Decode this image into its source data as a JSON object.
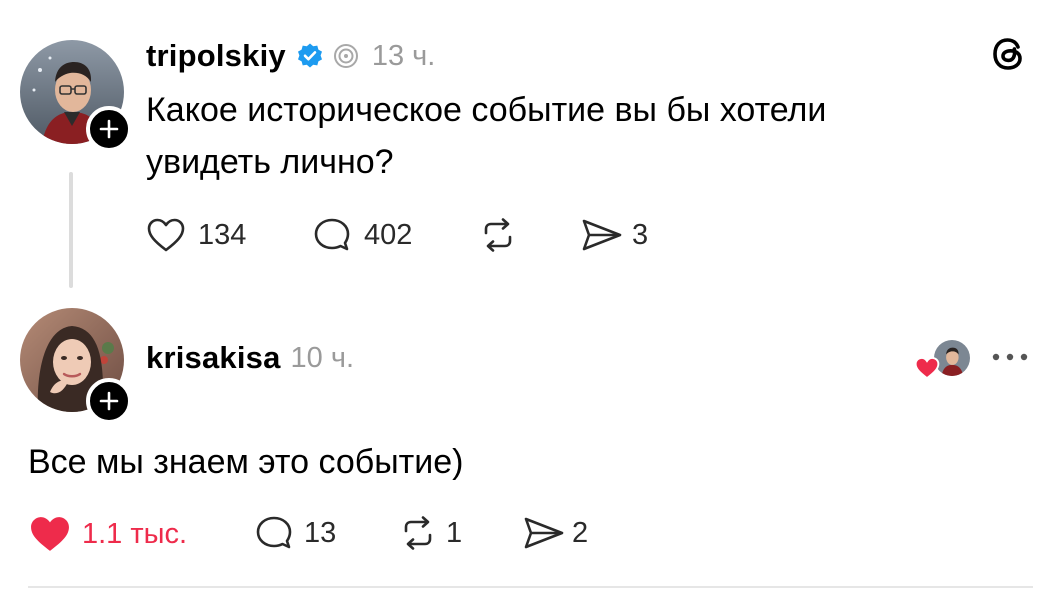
{
  "post": {
    "username": "tripolskiy",
    "time": "13 ч.",
    "text_line1": "Какое историческое событие вы бы хотели",
    "text_line2": "увидеть лично?",
    "likes": "134",
    "replies": "402",
    "reposts": "",
    "shares": "3",
    "verified": true
  },
  "reply": {
    "username": "krisakisa",
    "time": "10 ч.",
    "text": "Все мы знаем это событие)",
    "likes": "1.1 тыс.",
    "replies": "13",
    "reposts": "1",
    "shares": "2",
    "liked_by_author": true
  },
  "colors": {
    "like_red": "#ee2b4b",
    "verified_blue": "#1d9bf0",
    "muted": "#9a9a9a",
    "line": "#dcdcdc"
  },
  "icons": [
    "threads-logo-icon",
    "verified-badge-icon",
    "activity-icon",
    "heart-icon",
    "comment-icon",
    "repost-icon",
    "share-icon",
    "more-icon",
    "plus-icon"
  ]
}
